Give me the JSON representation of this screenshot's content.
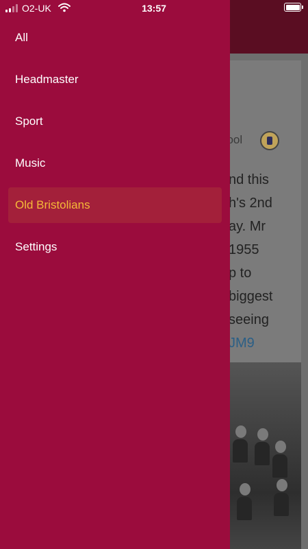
{
  "status_bar": {
    "carrier": "O2-UK",
    "time": "13:57",
    "signal_bars": 2,
    "icons": [
      "signal-icon",
      "wifi-icon",
      "battery-icon"
    ]
  },
  "drawer": {
    "background_color": "#9b0c3d",
    "active_color": "#f5b938",
    "items": [
      {
        "label": "All",
        "active": false
      },
      {
        "label": "Headmaster",
        "active": false
      },
      {
        "label": "Sport",
        "active": false
      },
      {
        "label": "Music",
        "active": false
      },
      {
        "label": "Old Bristolians",
        "active": true
      },
      {
        "label": "Settings",
        "active": false
      }
    ]
  },
  "background_content": {
    "school_name_fragment": "hool",
    "text_lines": [
      "nd this",
      "h's 2nd",
      "ay. Mr",
      "1955",
      "p to",
      "biggest",
      "seeing"
    ],
    "link_fragment": "JM9"
  }
}
